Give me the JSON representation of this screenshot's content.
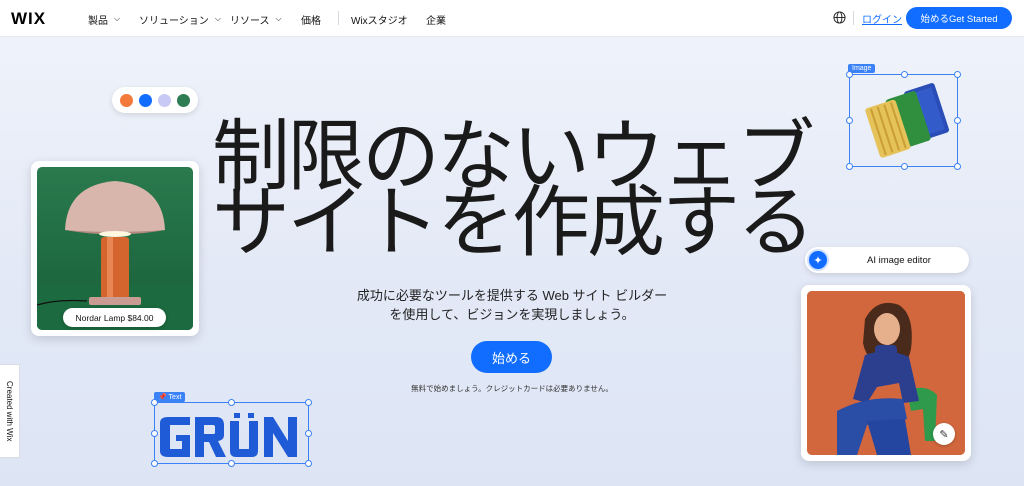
{
  "nav": {
    "logo": "WIX",
    "items": [
      {
        "label": "製品",
        "dropdown": true
      },
      {
        "label": "ソリューション",
        "dropdown": true
      },
      {
        "label": "リソース",
        "dropdown": true
      },
      {
        "label": "価格",
        "dropdown": false
      },
      {
        "label": "Wixスタジオ",
        "dropdown": false
      },
      {
        "label": "企業",
        "dropdown": false
      }
    ],
    "language_icon": "globe-icon",
    "login": "ログイン",
    "cta": "始めるGet Started"
  },
  "hero": {
    "headline_line1": "制限のないウェブ",
    "headline_line2": "サイトを作成する",
    "sub_line1": "成功に必要なツールを提供する Web サイト ビルダー",
    "sub_line2": "を使用して、ビジョンを実現しましょう。",
    "start_button": "始める",
    "fine_print": "無料で始めましょう。クレジットカードは必要ありません。"
  },
  "palette": {
    "colors": [
      "#f47a3c",
      "#116dff",
      "#c9c9f5",
      "#2f7d54"
    ]
  },
  "lamp_card": {
    "price_label": "Nordar Lamp $84.00"
  },
  "image_selection": {
    "tag": "Image"
  },
  "ai_editor": {
    "icon": "sparkle-icon",
    "label": "AI image editor"
  },
  "text_selection": {
    "tag": "Text",
    "logo_text": "GRÜN"
  },
  "woman_card": {
    "edit_icon": "pencil-sparkle-icon"
  },
  "badge": {
    "created_with": "Created with Wix"
  },
  "colors": {
    "accent": "#116dff",
    "selection": "#3b82f6"
  }
}
